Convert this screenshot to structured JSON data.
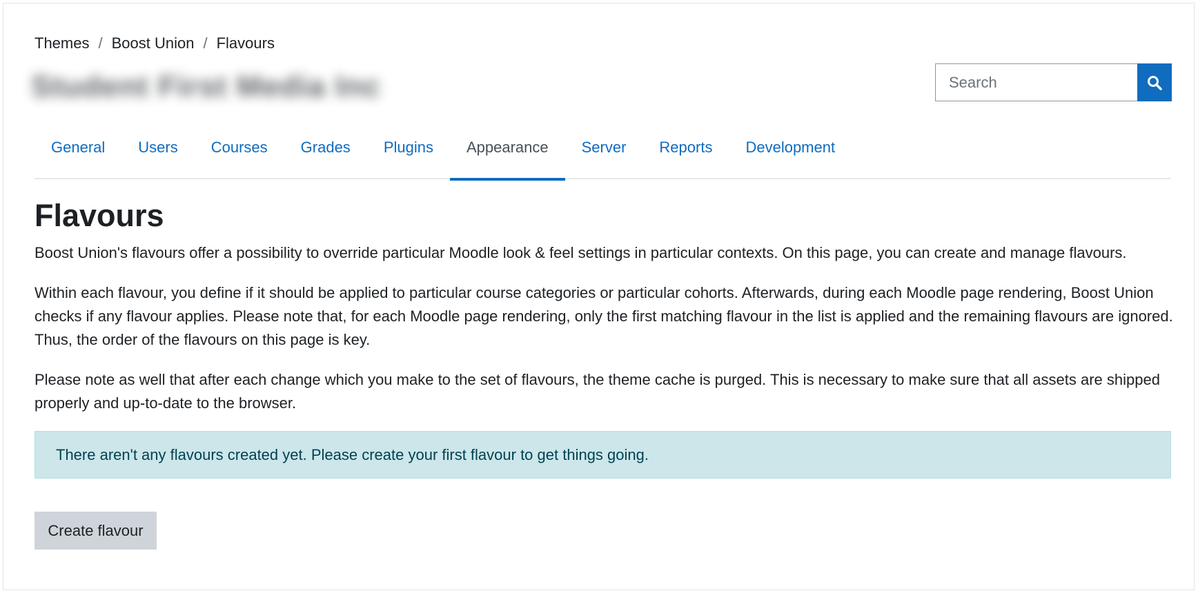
{
  "breadcrumb": {
    "items": [
      "Themes",
      "Boost Union",
      "Flavours"
    ],
    "separator": "/"
  },
  "site": {
    "name": "Student First Media Inc"
  },
  "search": {
    "placeholder": "Search",
    "icon": "search-icon"
  },
  "tabs": [
    {
      "label": "General"
    },
    {
      "label": "Users"
    },
    {
      "label": "Courses"
    },
    {
      "label": "Grades"
    },
    {
      "label": "Plugins"
    },
    {
      "label": "Appearance",
      "active": true
    },
    {
      "label": "Server"
    },
    {
      "label": "Reports"
    },
    {
      "label": "Development"
    }
  ],
  "page": {
    "title": "Flavours",
    "paragraphs": [
      "Boost Union's flavours offer a possibility to override particular Moodle look & feel settings in particular contexts. On this page, you can create and manage flavours.",
      "Within each flavour, you define if it should be applied to particular course categories or particular cohorts. Afterwards, during each Moodle page rendering, Boost Union checks if any flavour applies. Please note that, for each Moodle page rendering, only the first matching flavour in the list is applied and the remaining flavours are ignored. Thus, the order of the flavours on this page is key.",
      "Please note as well that after each change which you make to the set of flavours, the theme cache is purged. This is necessary to make sure that all assets are shipped properly and up-to-date to the browser."
    ],
    "alert": "There aren't any flavours created yet. Please create your first flavour to get things going.",
    "create_button": "Create flavour"
  },
  "colors": {
    "accent": "#0f6cbf",
    "alert_bg": "#cce6ea",
    "alert_text": "#004251",
    "button_bg": "#ced4da"
  }
}
